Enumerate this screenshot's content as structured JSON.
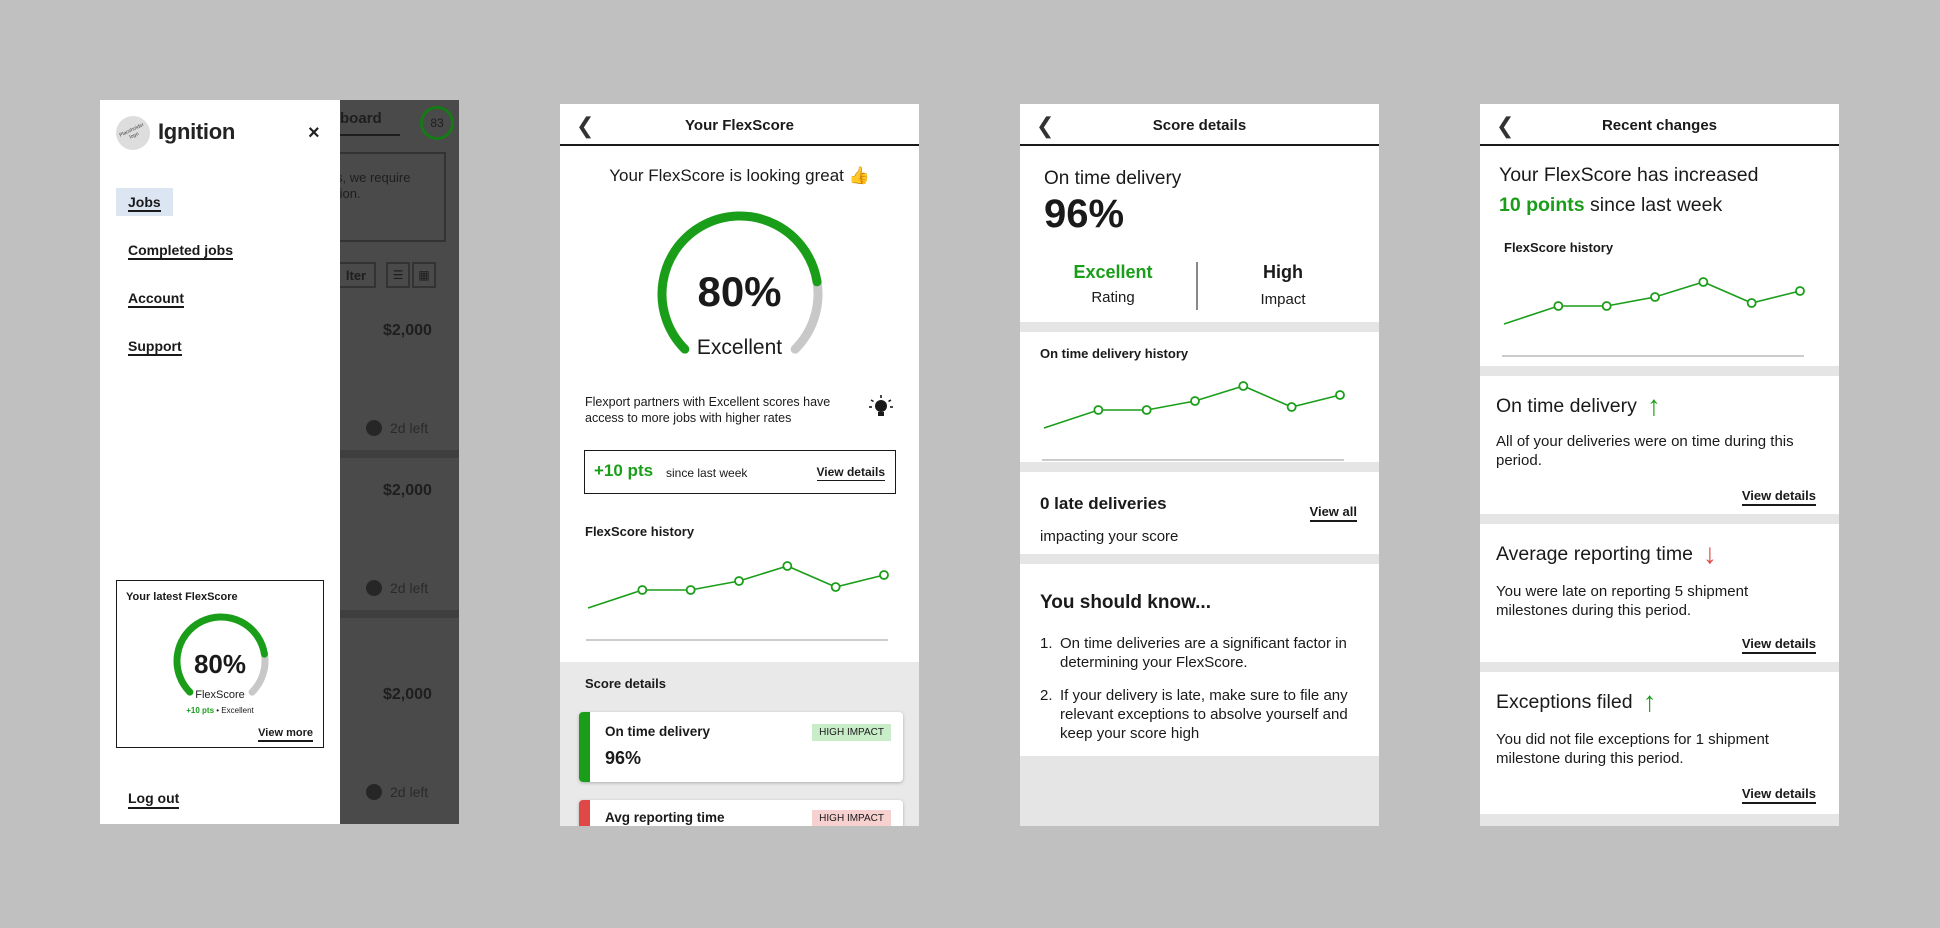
{
  "colors": {
    "green": "#1a9e1a",
    "red": "#e04848",
    "grey_track": "#c8c8c8",
    "badge_green_bg": "#c9ecc9",
    "badge_red_bg": "#f7d0d0",
    "nav_active_bg": "#dce5f2"
  },
  "menu_screen": {
    "logo_text": "Placeholder logo",
    "brand": "Ignition",
    "close_icon": "×",
    "nav": [
      "Jobs",
      "Completed jobs",
      "Account",
      "Support"
    ],
    "active_nav": "Jobs",
    "latest_card": {
      "title": "Your latest FlexScore",
      "percent": "80%",
      "score_value": 80,
      "label": "FlexScore",
      "pts": "+10 pts",
      "dot": "•",
      "rating": "Excellent",
      "view_more": "View more"
    },
    "logout": "Log out",
    "background": {
      "title": "board",
      "score": "83",
      "notice": "s, we require tion.",
      "filter": "lter",
      "prices": [
        "$2,000",
        "$2,000",
        "$2,000"
      ],
      "time_left": [
        "2d left",
        "2d left",
        "2d left"
      ]
    }
  },
  "flexscore_screen": {
    "title": "Your FlexScore",
    "headline": "Your FlexScore is looking great 👍",
    "percent": "80%",
    "score_value": 80,
    "rating": "Excellent",
    "tip": "Flexport partners with Excellent scores have access to more jobs with higher rates",
    "pts": "+10 pts",
    "since": "since last week",
    "view_details": "View details",
    "history_title": "FlexScore history",
    "score_details_title": "Score details",
    "details": [
      {
        "title": "On time delivery",
        "value": "96%",
        "badge": "HIGH IMPACT"
      },
      {
        "title": "Avg reporting time",
        "value": "",
        "badge": "HIGH IMPACT"
      }
    ]
  },
  "score_details_screen": {
    "title": "Score details",
    "metric": "On time delivery",
    "value": "96%",
    "rating_value": "Excellent",
    "rating_label": "Rating",
    "impact_value": "High",
    "impact_label": "Impact",
    "history_title": "On time delivery history",
    "late_title": "0 late deliveries",
    "late_sub": "impacting your score",
    "view_all": "View all",
    "know_title": "You should know...",
    "tips": [
      {
        "num": "1.",
        "text": "On time deliveries are a significant factor in determining your FlexScore."
      },
      {
        "num": "2.",
        "text": "If your delivery is late, make sure to file any relevant exceptions to absolve yourself and keep your score high"
      }
    ]
  },
  "recent_changes_screen": {
    "title": "Recent changes",
    "line1": "Your FlexScore has increased",
    "points": "10 points",
    "line2_rest": " since last week",
    "history_title": "FlexScore history",
    "changes": [
      {
        "title": "On time delivery",
        "direction": "up",
        "arrow": "↑",
        "text": "All of your deliveries were on time during this period.",
        "link": "View details"
      },
      {
        "title": "Average reporting time",
        "direction": "down",
        "arrow": "↓",
        "text": "You were late on reporting 5 shipment milestones during this period.",
        "link": "View details"
      },
      {
        "title": "Exceptions filed",
        "direction": "up",
        "arrow": "↑",
        "text": "You did not file exceptions for 1 shipment milestone during this period.",
        "link": "View details"
      }
    ]
  },
  "icons": {
    "back": "chevron-left-icon",
    "close": "close-icon",
    "bulb": "lightbulb-icon",
    "clock": "clock-icon"
  },
  "chart_data": [
    {
      "type": "line",
      "title": "FlexScore history",
      "series": [
        {
          "values": [
            0.9,
            0.6,
            0.6,
            0.45,
            0.2,
            0.55,
            0.35
          ]
        }
      ],
      "markers_from_index": 1
    },
    {
      "type": "line",
      "title": "On time delivery history",
      "series": [
        {
          "values": [
            0.9,
            0.6,
            0.6,
            0.45,
            0.2,
            0.55,
            0.35
          ]
        }
      ],
      "markers_from_index": 1
    },
    {
      "type": "line",
      "title": "FlexScore history",
      "series": [
        {
          "values": [
            0.9,
            0.6,
            0.6,
            0.45,
            0.2,
            0.55,
            0.35
          ]
        }
      ],
      "markers_from_index": 1
    }
  ]
}
